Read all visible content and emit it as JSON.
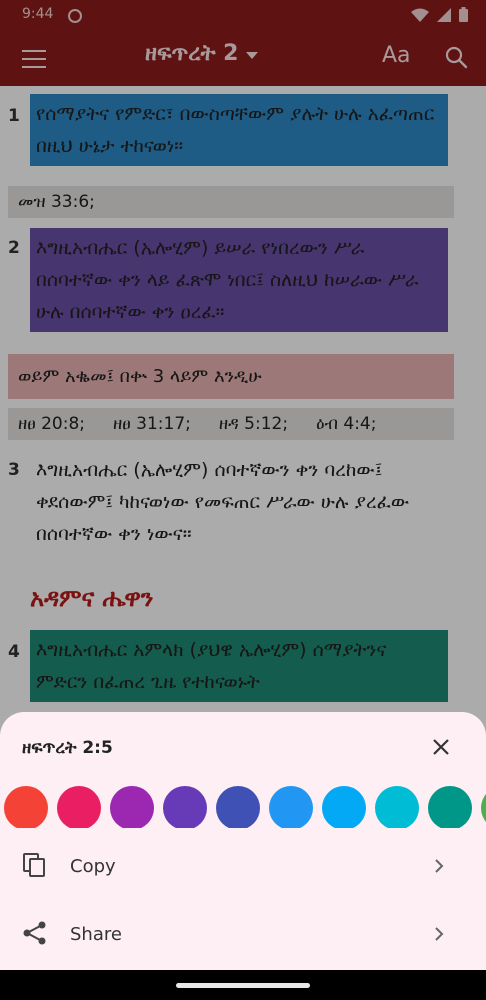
{
  "status": {
    "time": "9:44"
  },
  "app": {
    "title": "ዘፍጥረት 2",
    "font_button": "Aa"
  },
  "verses": [
    {
      "num": "1",
      "text": "የሰማያትና የምድር፣ በውስጣቸውም ያሉት ሁሉ አፈጣጠር በዚህ ሁኔታ ተከናወነ።",
      "highlight": "#2e88c6"
    },
    {
      "num": "2",
      "text": "እግዚአብሔር (ኤሎሂም) ይሠራ የነበረውን ሥራ በሰባተኛው ቀን ላይ ፈጽሞ ነበር፤ ስለዚህ ከሠራው ሥራ ሁሉ በሰባተኛው ቀን ዐረፈ።",
      "highlight": "#6a4fa8"
    },
    {
      "num": "3",
      "text": "እግዚአብሔር (ኤሎሂም) ሰባተኛውን ቀን ባረከው፤ ቀደሰውም፤ ካከናወነው የመፍጠር ሥራው ሁሉ ያረፈው በሰባተኛው ቀን ነውና።"
    },
    {
      "num": "4",
      "text": "እግዚአብሔር አምላክ (ያህዌ ኤሎሂም) ሰማያትንና ምድርን በፈጠረ ጊዜ የተከናወኑት",
      "highlight": "#1f8a73"
    }
  ],
  "refs_v1": "መዝ 33:6;",
  "note_v2": "ወይም አቈመ፤ በቍ 3 ላይም እንዲሁ",
  "refs_v2": [
    "ዘፀ 20:8;",
    "ዘፀ 31:17;",
    "ዘዳ 5:12;",
    "ዕብ 4:4;"
  ],
  "section_heading": "አዳምና ሔዋን",
  "sheet": {
    "title": "ዘፍጥረት 2:5",
    "copy_label": "Copy",
    "share_label": "Share",
    "colors": [
      "#f44336",
      "#e91e63",
      "#9c27b0",
      "#673ab7",
      "#3f51b5",
      "#2196f3",
      "#03a9f4",
      "#00bcd4",
      "#009688",
      "#4caf50"
    ]
  }
}
